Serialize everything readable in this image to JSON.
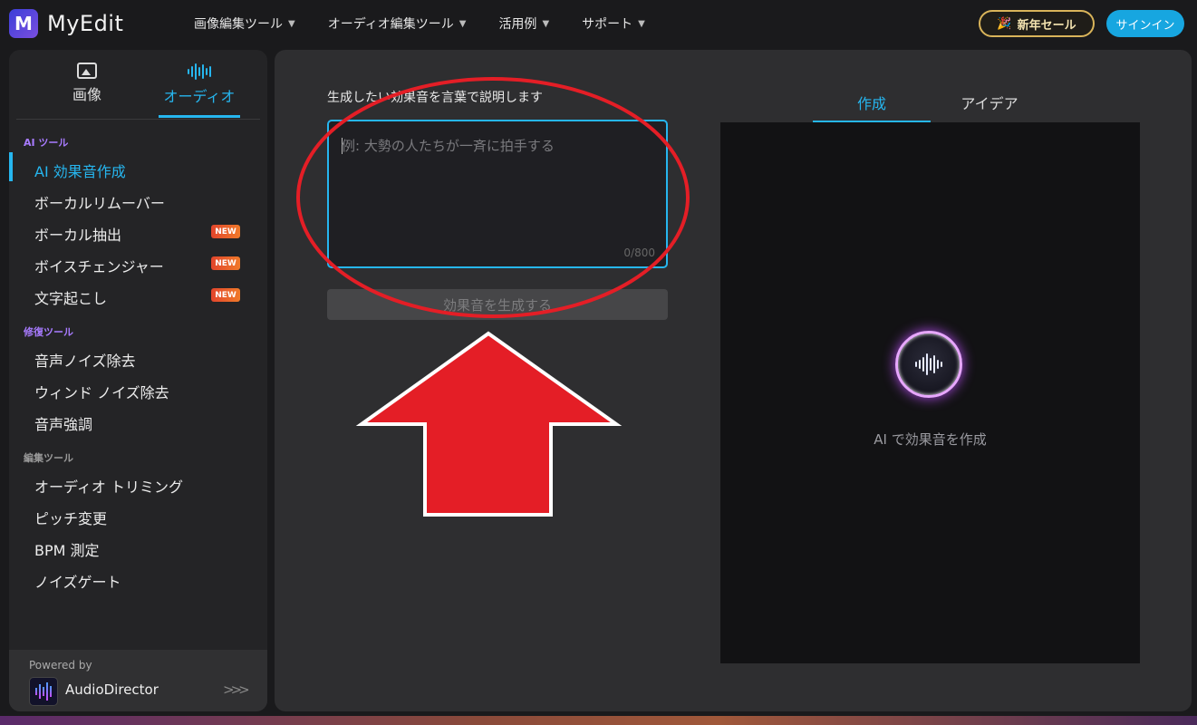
{
  "app": {
    "logo_letter": "M",
    "name": "MyEdit"
  },
  "nav": {
    "items": [
      {
        "label": "画像編集ツール"
      },
      {
        "label": "オーディオ編集ツール"
      },
      {
        "label": "活用例"
      },
      {
        "label": "サポート"
      }
    ]
  },
  "header": {
    "sale_label": "新年セール",
    "sale_icon": "party-popper-icon",
    "signin_label": "サインイン"
  },
  "sidebar": {
    "tabs": {
      "image": "画像",
      "audio": "オーディオ"
    },
    "sections": [
      {
        "title": "AI ツール",
        "color": "#a87bff"
      },
      {
        "title": "修復ツール",
        "color": "#a87bff"
      },
      {
        "title": "編集ツール",
        "color": "#9a9a9a"
      }
    ],
    "ai_items": [
      {
        "label": "AI 効果音作成"
      },
      {
        "label": "ボーカルリムーバー"
      },
      {
        "label": "ボーカル抽出",
        "badge": "NEW"
      },
      {
        "label": "ボイスチェンジャー",
        "badge": "NEW"
      },
      {
        "label": "文字起こし",
        "badge": "NEW"
      }
    ],
    "repair_items": [
      {
        "label": "音声ノイズ除去"
      },
      {
        "label": "ウィンド ノイズ除去"
      },
      {
        "label": "音声強調"
      }
    ],
    "edit_items": [
      {
        "label": "オーディオ トリミング"
      },
      {
        "label": "ピッチ変更"
      },
      {
        "label": "BPM 測定"
      },
      {
        "label": "ノイズゲート"
      }
    ],
    "powered": {
      "label": "Powered by",
      "name": "AudioDirector"
    }
  },
  "main": {
    "prompt_label": "生成したい効果音を言葉で説明します",
    "placeholder": "例: 大勢の人たちが一斉に拍手する",
    "counter": "0/800",
    "generate_label": "効果音を生成する",
    "tabs": {
      "create": "作成",
      "ideas": "アイデア"
    },
    "preview_caption": "AI で効果音を作成"
  },
  "colors": {
    "accent": "#26b6ef",
    "annotation": "#e41e26"
  }
}
